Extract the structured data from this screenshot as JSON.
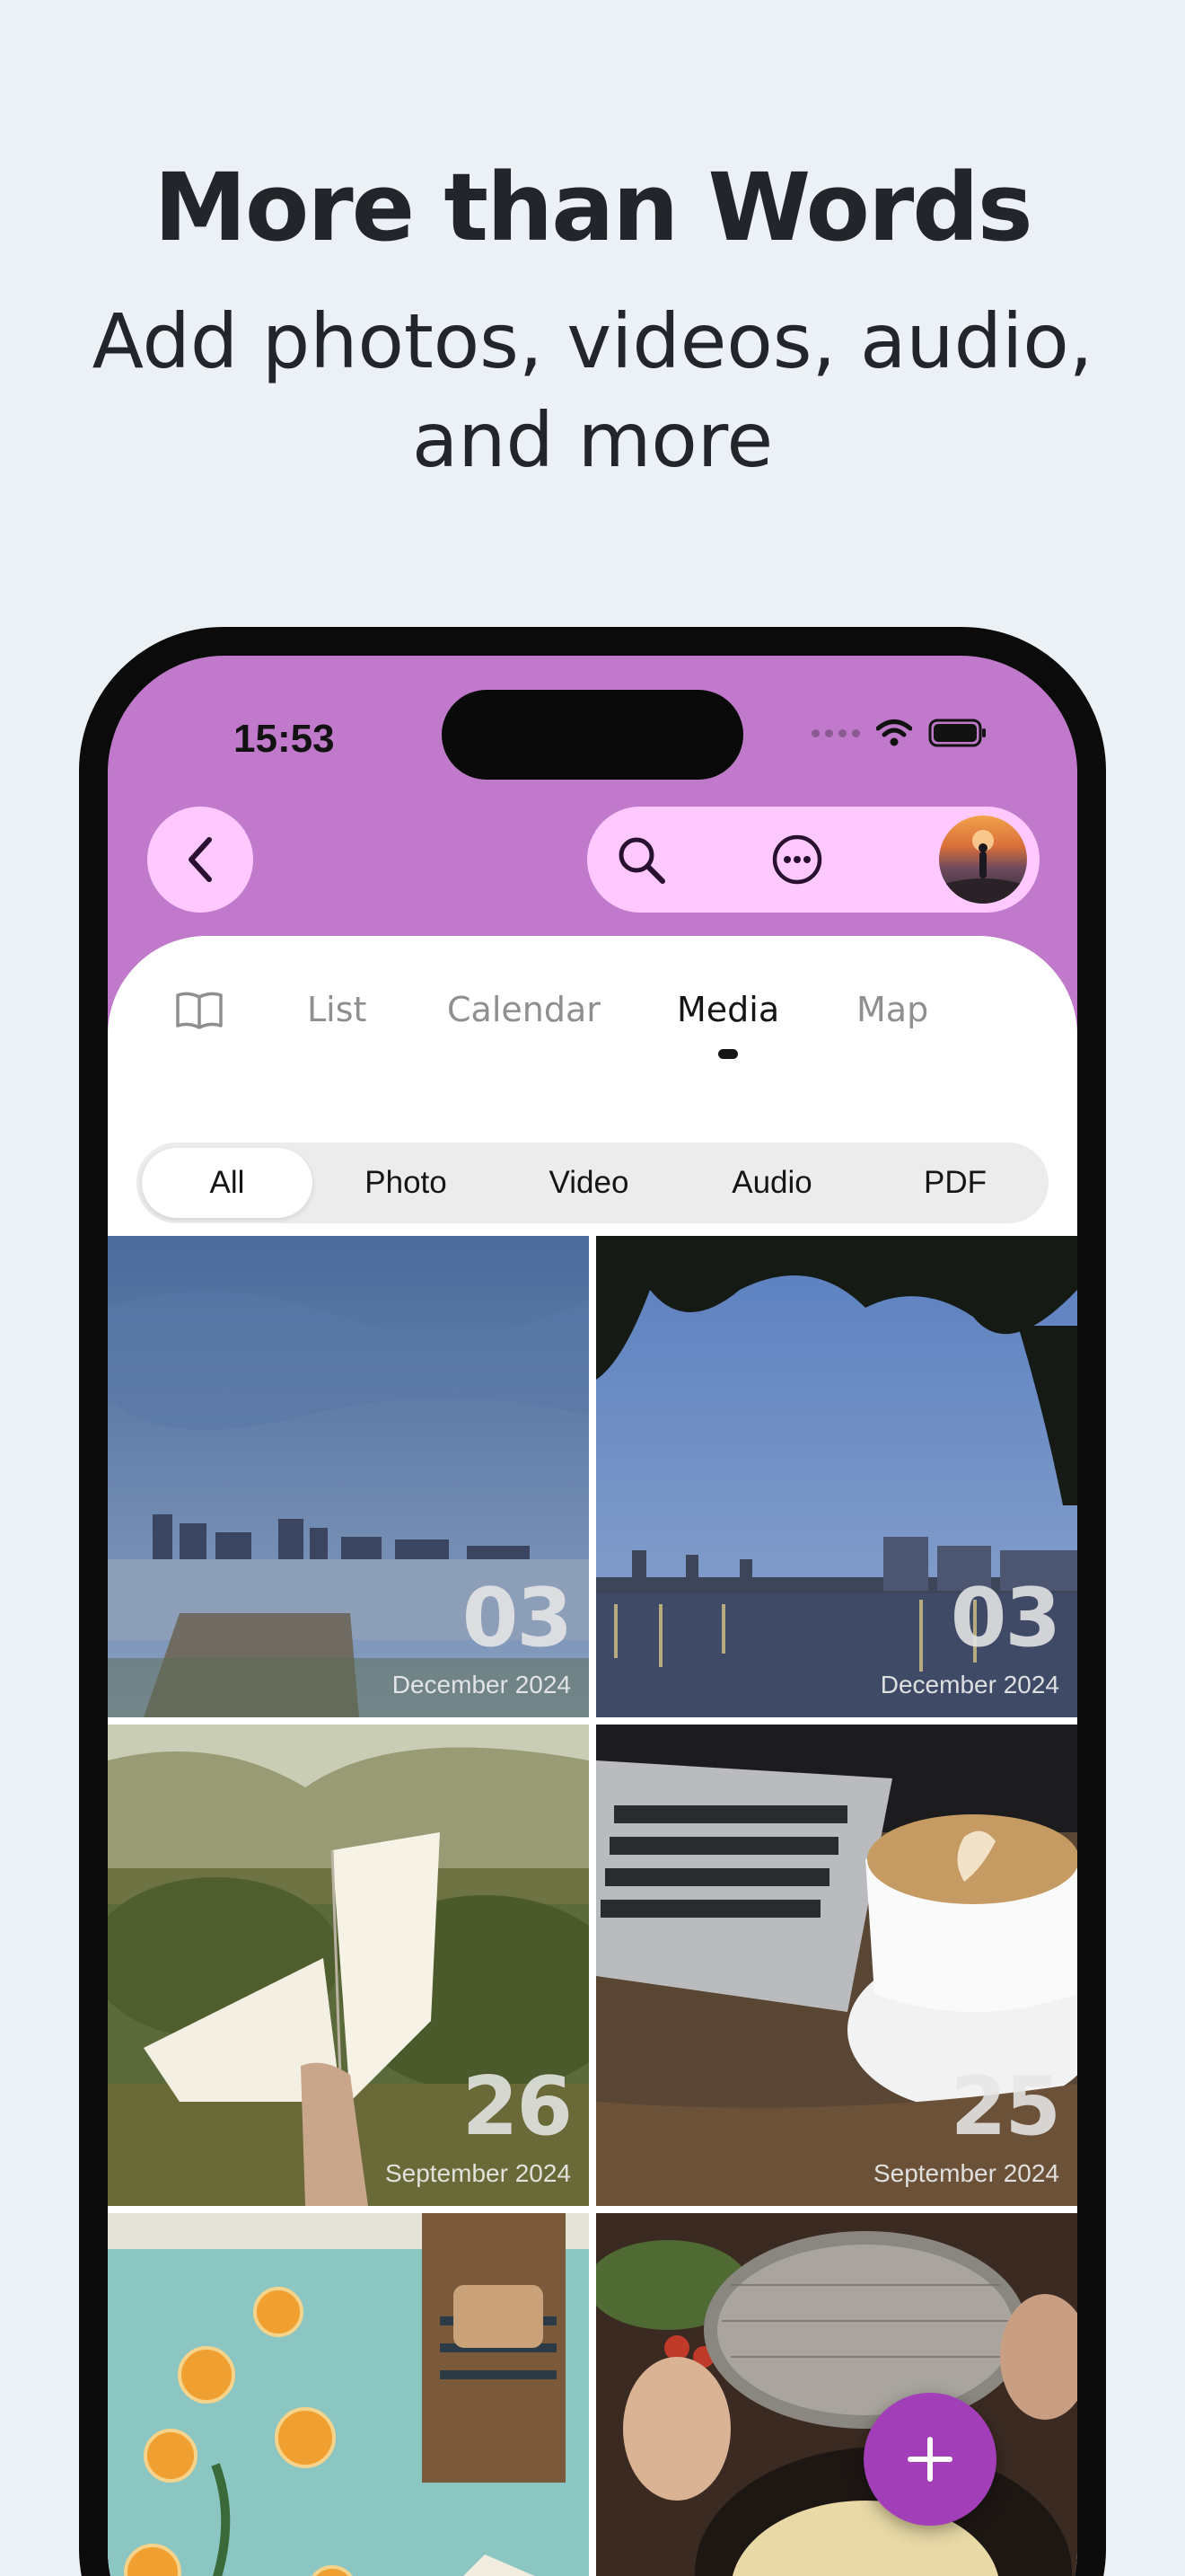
{
  "promo": {
    "headline": "More than Words",
    "subline": "Add photos, videos, audio, and more"
  },
  "status_bar": {
    "time": "15:53"
  },
  "colors": {
    "header_bg": "#c17acb",
    "pill_bg": "#ffc8ff",
    "fab_bg": "#a23fb8",
    "page_bg": "#ecf1f5"
  },
  "icons": {
    "back": "chevron-left-icon",
    "search": "search-icon",
    "more": "ellipsis-circle-icon",
    "journal": "book-icon",
    "fab": "plus-icon"
  },
  "tabs": [
    {
      "label": "List"
    },
    {
      "label": "Calendar"
    },
    {
      "label": "Media",
      "active": true
    },
    {
      "label": "Map"
    }
  ],
  "filters": [
    {
      "label": "All",
      "active": true
    },
    {
      "label": "Photo"
    },
    {
      "label": "Video"
    },
    {
      "label": "Audio"
    },
    {
      "label": "PDF"
    }
  ],
  "media": [
    {
      "day": "03",
      "month": "December 2024",
      "scene": "river skyline at dusk"
    },
    {
      "day": "03",
      "month": "December 2024",
      "scene": "bridge under tree branches"
    },
    {
      "day": "26",
      "month": "September 2024",
      "scene": "open book held in forest"
    },
    {
      "day": "25",
      "month": "September 2024",
      "scene": "latte and laptop on wood"
    },
    {
      "scene": "bath with orange slices"
    },
    {
      "scene": "cooking pasta with strainer"
    }
  ]
}
